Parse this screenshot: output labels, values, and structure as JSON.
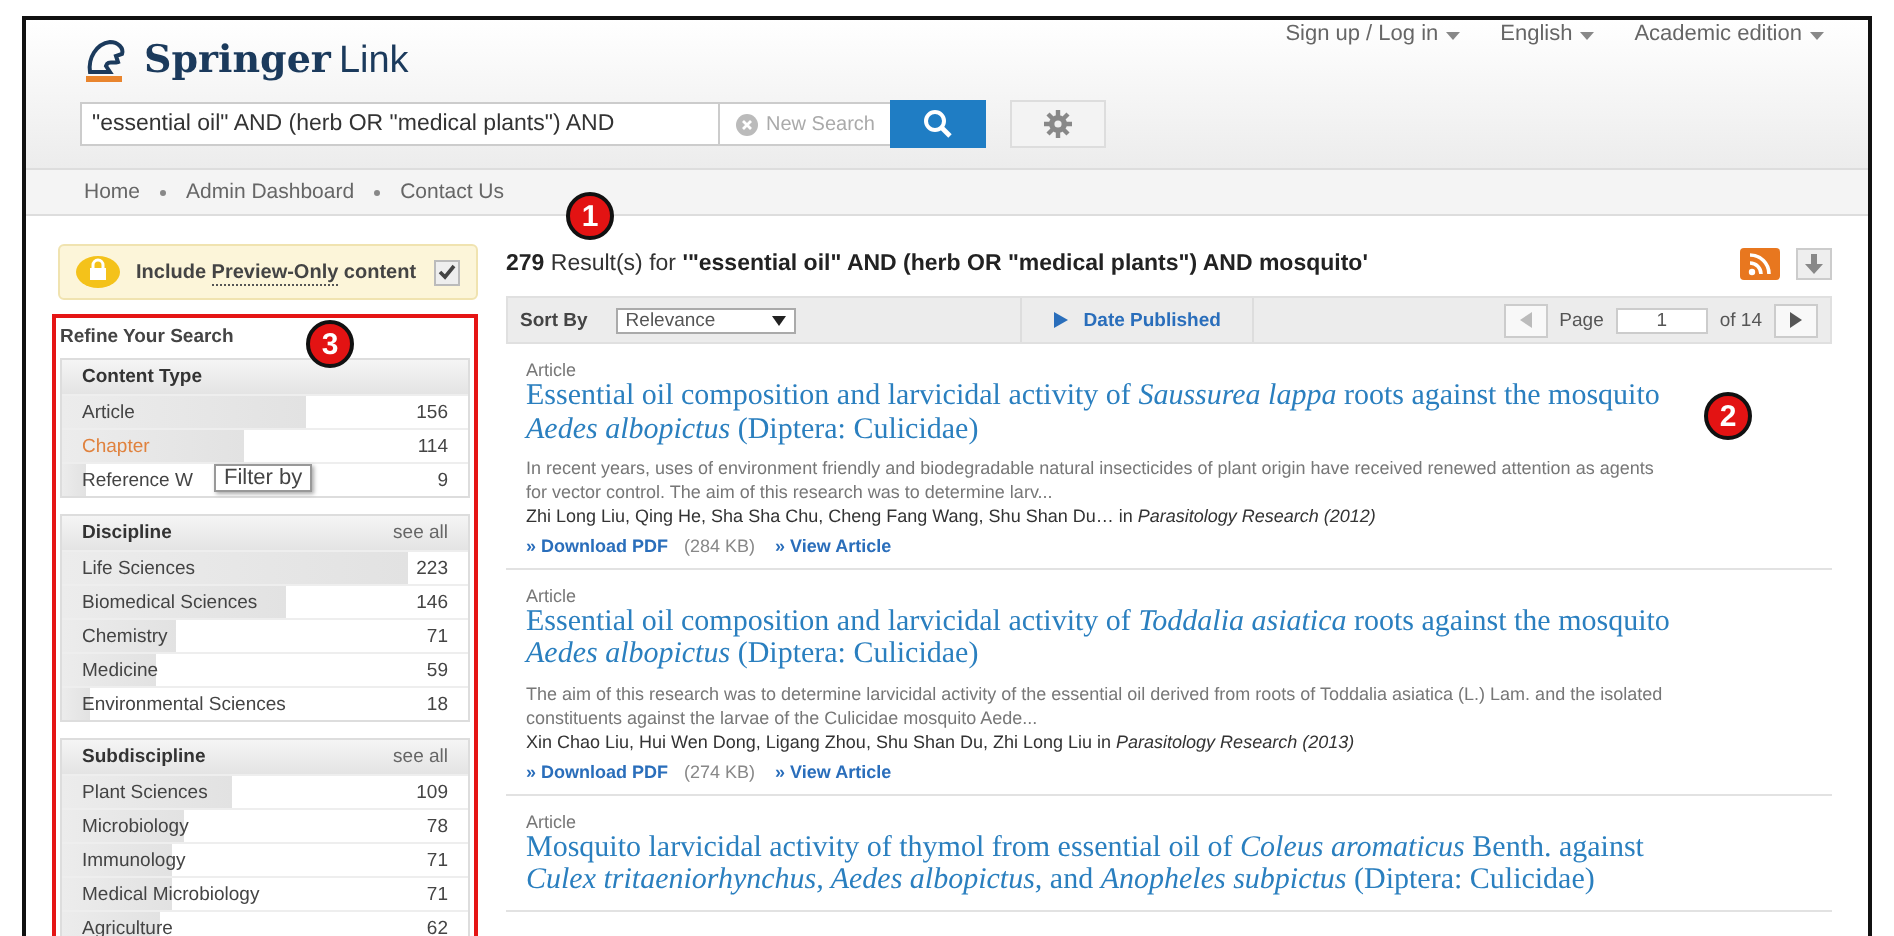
{
  "header": {
    "logo": {
      "bold": "Springer",
      "light": "Link"
    },
    "links": [
      "Sign up / Log in",
      "English",
      "Academic edition"
    ],
    "search": {
      "value": "\"essential oil\" AND (herb OR \"medical plants\") AND",
      "clear_label": "New Search"
    }
  },
  "breadcrumbs": [
    "Home",
    "Admin Dashboard",
    "Contact Us"
  ],
  "preview": {
    "label": "Include **Preview-Only** content",
    "checked": true
  },
  "refine": {
    "title": "Refine Your Search",
    "facets": [
      {
        "title": "Content Type",
        "items": [
          {
            "label": "Article",
            "count": "156",
            "level": 0.6,
            "hover": false
          },
          {
            "label": "Chapter",
            "count": "114",
            "level": 0.45,
            "hover": true
          },
          {
            "label": "Reference W",
            "count": "9",
            "level": 0.06,
            "hover": false,
            "tooltip": "Filter by"
          }
        ]
      },
      {
        "title": "Discipline",
        "see_all": "see all",
        "items": [
          {
            "label": "Life Sciences",
            "count": "223",
            "level": 0.85,
            "hover": false
          },
          {
            "label": "Biomedical Sciences",
            "count": "146",
            "level": 0.55,
            "hover": false
          },
          {
            "label": "Chemistry",
            "count": "71",
            "level": 0.28,
            "hover": false
          },
          {
            "label": "Medicine",
            "count": "59",
            "level": 0.23,
            "hover": false
          },
          {
            "label": "Environmental Sciences",
            "count": "18",
            "level": 0.07,
            "hover": false
          }
        ]
      },
      {
        "title": "Subdiscipline",
        "see_all": "see all",
        "items": [
          {
            "label": "Plant Sciences",
            "count": "109",
            "level": 0.42,
            "hover": false
          },
          {
            "label": "Microbiology",
            "count": "78",
            "level": 0.3,
            "hover": false
          },
          {
            "label": "Immunology",
            "count": "71",
            "level": 0.27,
            "hover": false
          },
          {
            "label": "Medical Microbiology",
            "count": "71",
            "level": 0.27,
            "hover": false
          },
          {
            "label": "Agriculture",
            "count": "62",
            "level": 0.24,
            "hover": false
          }
        ]
      }
    ]
  },
  "results": {
    "count": "279",
    "label": "Result(s) for",
    "query": "'\"essential oil\" AND (herb OR \"medical plants\") AND mosquito'",
    "sort_label": "Sort By",
    "sort_value": "Relevance",
    "date_label": "Date Published",
    "page_label": "Page",
    "page_value": "1",
    "page_total": "of 14",
    "items": [
      {
        "type": "Article",
        "title": "Essential oil composition and larvicidal activity of *Saussurea lappa* roots against the mosquito *Aedes albopictus* (Diptera: Culicidae)",
        "snippet": "In recent years, uses of environment friendly and biodegradable natural insecticides of plant origin have received renewed attention as agents for vector control. The aim of this research was to determine larv...",
        "authors": "Zhi Long Liu, Qing He, Sha Sha Chu, Cheng Fang Wang, Shu Shan Du… in *Parasitology Research (2012)*",
        "pdf": "» Download PDF",
        "size": "(284 KB)",
        "view": "» View Article"
      },
      {
        "type": "Article",
        "title": "Essential oil composition and larvicidal activity of *Toddalia asiatica* roots against the mosquito *Aedes albopictus* (Diptera: Culicidae)",
        "snippet": "The aim of this research was to determine larvicidal activity of the essential oil derived from roots of Toddalia asiatica (L.) Lam. and the isolated constituents against the larvae of the Culicidae mosquito Aede...",
        "authors": "Xin Chao Liu, Hui Wen Dong, Ligang Zhou, Shu Shan Du, Zhi Long Liu in *Parasitology Research (2013)*",
        "pdf": "» Download PDF",
        "size": "(274 KB)",
        "view": "» View Article"
      },
      {
        "type": "Article",
        "title": "Mosquito larvicidal activity of thymol from essential oil of *Coleus aromaticus* Benth. against *Culex tritaeniorhynchus, Aedes albopictus,* and *Anopheles subpictus* (Diptera: Culicidae)"
      }
    ]
  },
  "callouts": [
    "1",
    "2",
    "3"
  ]
}
